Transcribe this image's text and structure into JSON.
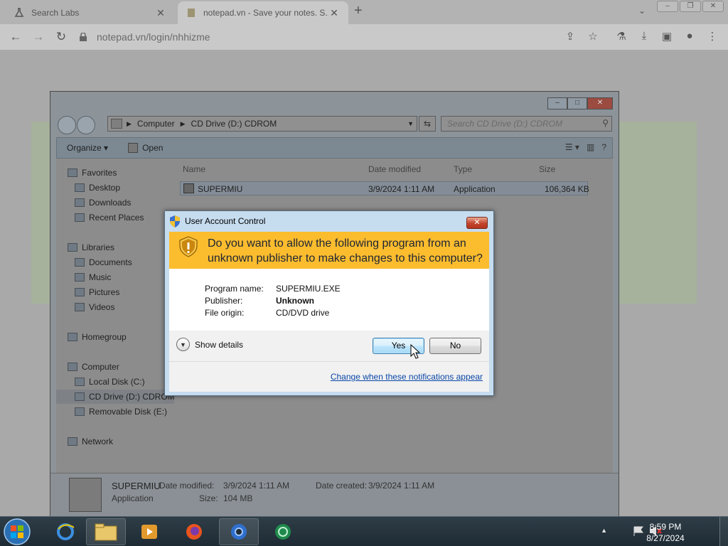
{
  "browser": {
    "tabs": [
      {
        "title": "Search Labs"
      },
      {
        "title": "notepad.vn - Save your notes. S..."
      }
    ],
    "url": "notepad.vn/login/nhhizme",
    "new_tab_symbol": "+",
    "tab_close_symbol": "✕"
  },
  "explorer": {
    "address": [
      "Computer",
      "CD Drive (D:) CDROM"
    ],
    "search_placeholder": "Search CD Drive (D:) CDROM",
    "toolbar": {
      "organize": "Organize ▾",
      "open": "Open"
    },
    "nav": {
      "favorites": "Favorites",
      "desktop": "Desktop",
      "downloads": "Downloads",
      "recent": "Recent Places",
      "libraries": "Libraries",
      "documents": "Documents",
      "music": "Music",
      "pictures": "Pictures",
      "videos": "Videos",
      "homegroup": "Homegroup",
      "computer": "Computer",
      "local_disk": "Local Disk (C:)",
      "cd_drive": "CD Drive (D:) CDROM",
      "removable": "Removable Disk (E:)",
      "network": "Network"
    },
    "columns": {
      "name": "Name",
      "date": "Date modified",
      "type": "Type",
      "size": "Size"
    },
    "file": {
      "name": "SUPERMIU",
      "date": "3/9/2024 1:11 AM",
      "type": "Application",
      "size": "106,364 KB"
    },
    "details": {
      "name": "SUPERMIU",
      "kind": "Application",
      "modified_label": "Date modified:",
      "modified": "3/9/2024 1:11 AM",
      "size_label": "Size:",
      "size": "104 MB",
      "created_label": "Date created:",
      "created": "3/9/2024 1:11 AM"
    }
  },
  "uac": {
    "title": "User Account Control",
    "question_line1": "Do you want to allow the following program from an",
    "question_line2": "unknown publisher to make changes to this computer?",
    "program_label": "Program name:",
    "program": "SUPERMIU.EXE",
    "publisher_label": "Publisher:",
    "publisher": "Unknown",
    "origin_label": "File origin:",
    "origin": "CD/DVD drive",
    "show_details": "Show details",
    "yes": "Yes",
    "no": "No",
    "link": "Change when these notifications appear",
    "colors": {
      "banner": "#fbbc2e",
      "link": "#0a47a8"
    }
  },
  "taskbar": {
    "time": "8:59 PM",
    "date": "8/27/2024",
    "apps": [
      "internet-explorer-icon",
      "windows-explorer-icon",
      "media-player-icon",
      "firefox-icon",
      "chrome-icon",
      "app-icon"
    ]
  }
}
